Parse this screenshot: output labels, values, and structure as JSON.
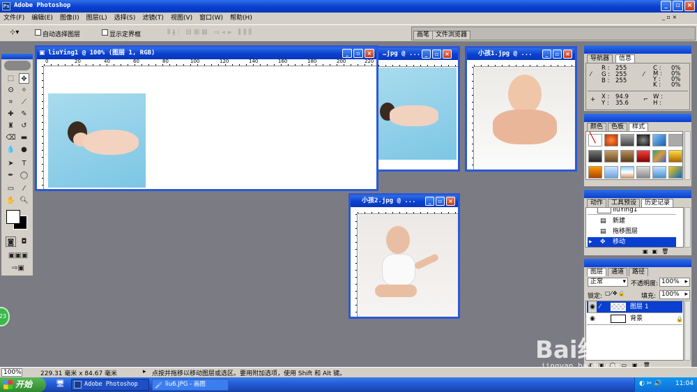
{
  "app": {
    "title": "Adobe Photoshop"
  },
  "menu": [
    "文件(F)",
    "编辑(E)",
    "图像(I)",
    "图层(L)",
    "选择(S)",
    "滤镜(T)",
    "视图(V)",
    "窗口(W)",
    "帮助(H)"
  ],
  "options": {
    "auto_select": "自动选择图层",
    "show_bounds": "显示定界框",
    "tab_brush": "画笔",
    "tab_filebrowser": "文件浏览器"
  },
  "docs": {
    "main": {
      "title": "liuYing1 @ 100% (图层 1, RGB)",
      "ruler": [
        "0",
        "20",
        "40",
        "60",
        "80",
        "100",
        "120",
        "140",
        "160",
        "180",
        "200",
        "220"
      ]
    },
    "doc2": {
      "title": "…jpg @ ..."
    },
    "child1": {
      "title": "小孩1.jpg @ ..."
    },
    "child2": {
      "title": "小孩2.jpg @ ..."
    }
  },
  "info": {
    "tabs": [
      "导航器",
      "信息"
    ],
    "rgb": {
      "r_label": "R :",
      "r": "255",
      "g_label": "G :",
      "g": "255",
      "b_label": "B :",
      "b": "255"
    },
    "cmyk": {
      "c_label": "C :",
      "c": "0%",
      "m_label": "M :",
      "m": "0%",
      "y_label": "Y :",
      "y": "0%",
      "k_label": "K :",
      "k": "0%"
    },
    "xy": {
      "x_label": "X :",
      "x": "94.9",
      "y_label": "Y :",
      "y": "35.6"
    },
    "wh": {
      "w_label": "W :",
      "h_label": "H :"
    }
  },
  "swatches": {
    "tabs": [
      "颜色",
      "色板",
      "样式"
    ]
  },
  "history": {
    "tabs": [
      "动作",
      "工具预设",
      "历史记录"
    ],
    "snapshot": "liuYing1",
    "items": [
      "新建",
      "拖移图层",
      "移动"
    ]
  },
  "layers": {
    "tabs": [
      "图层",
      "通道",
      "路径"
    ],
    "blend": "正常",
    "opacity_label": "不透明度:",
    "opacity": "100%",
    "lock_label": "锁定:",
    "fill_label": "填充:",
    "fill": "100%",
    "items": [
      "图层 1",
      "背景"
    ]
  },
  "status": {
    "zoom": "100%",
    "size": "229.31 毫米 x 84.67 毫米",
    "hint": "点按并拖移以移动图层或选区。要用附加选项，使用 Shift 和 Alt 键。"
  },
  "taskbar": {
    "start": "开始",
    "items": [
      "Adobe Photoshop",
      "liu6.JPG - 画图"
    ],
    "clock": "11:04",
    "badge": "23"
  },
  "watermark": {
    "logo": "Bai经验",
    "url": "jingyan.baidu.com"
  }
}
